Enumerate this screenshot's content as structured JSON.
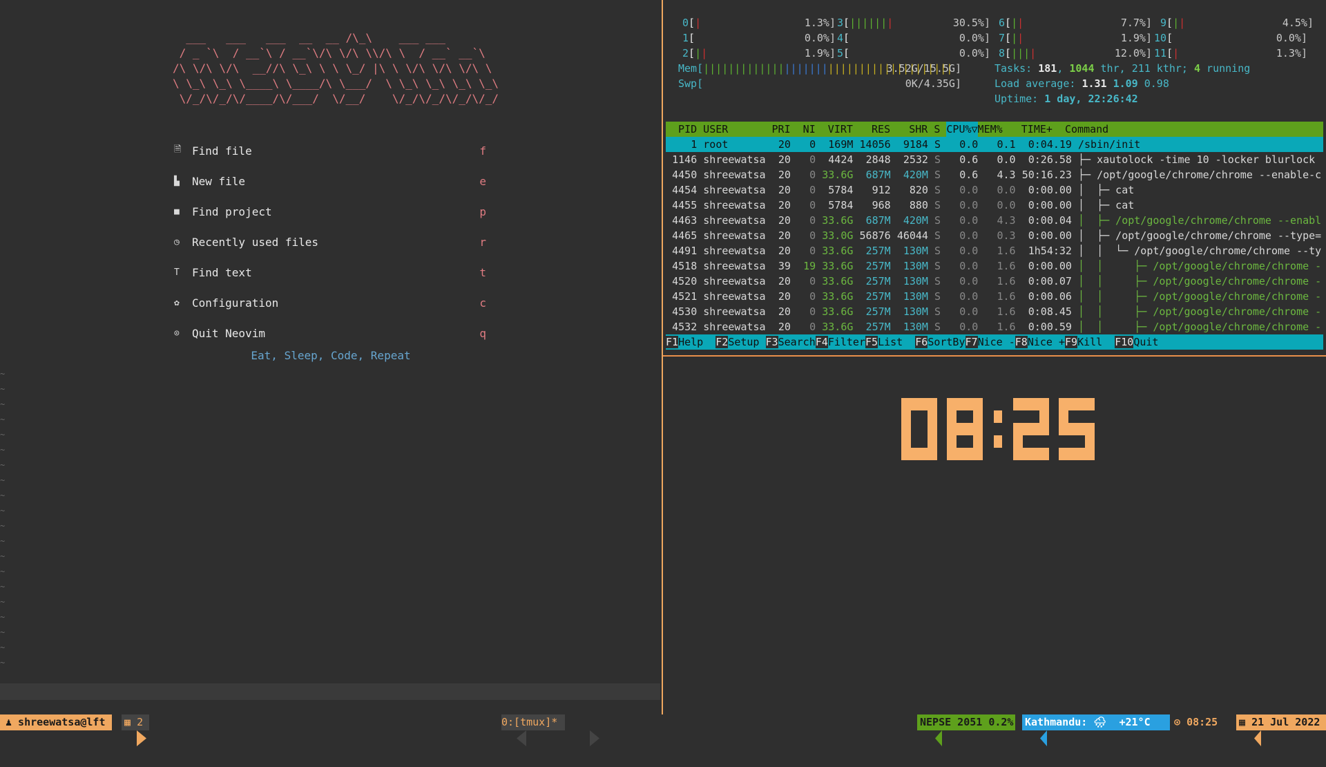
{
  "dashboard": {
    "logo": "  ___   ___   ___  __  __ /\\_\\    ___ ___\n / _ `\\  / __`\\ / __`\\/\\ \\/\\ \\\\/\\ \\  / __` __`\\\n/\\ \\/\\ \\/\\  __//\\ \\_\\ \\ \\ \\_/ |\\ \\ \\/\\ \\/\\ \\/\\ \\\n\\ \\_\\ \\_\\ \\____\\ \\____/\\ \\___/  \\ \\_\\ \\_\\ \\_\\ \\_\\\n \\/_/\\/_/\\/____/\\/___/  \\/__/    \\/_/\\/_/\\/_/\\/_/",
    "items": [
      {
        "icon": "find-file-icon",
        "glyph": "🗎",
        "label": "Find file",
        "key": "f"
      },
      {
        "icon": "new-file-icon",
        "glyph": "▙",
        "label": "New file",
        "key": "e"
      },
      {
        "icon": "folder-icon",
        "glyph": "■",
        "label": "Find project",
        "key": "p"
      },
      {
        "icon": "clock-icon",
        "glyph": "◷",
        "label": "Recently used files",
        "key": "r"
      },
      {
        "icon": "text-icon",
        "glyph": "T",
        "label": "Find text",
        "key": "t"
      },
      {
        "icon": "gear-icon",
        "glyph": "✿",
        "label": "Configuration",
        "key": "c"
      },
      {
        "icon": "power-icon",
        "glyph": "⊙",
        "label": "Quit Neovim",
        "key": "q"
      }
    ],
    "tagline": "Eat, Sleep, Code, Repeat"
  },
  "htop": {
    "cpus": [
      {
        "n": "0",
        "bars": "|",
        "val": "1.3%]"
      },
      {
        "n": "1",
        "bars": "",
        "val": "0.0%]"
      },
      {
        "n": "2",
        "bars": "||",
        "val": "1.9%]"
      },
      {
        "n": "3",
        "bars": "|||||||",
        "val": "30.5%]"
      },
      {
        "n": "4",
        "bars": "",
        "val": "0.0%]"
      },
      {
        "n": "5",
        "bars": "",
        "val": "0.0%]"
      },
      {
        "n": "6",
        "bars": "||",
        "val": "7.7%]"
      },
      {
        "n": "7",
        "bars": "||",
        "val": "1.9%]"
      },
      {
        "n": "8",
        "bars": "||||",
        "val": "12.0%]"
      },
      {
        "n": "9",
        "bars": "||",
        "val": "4.5%]"
      },
      {
        "n": "10",
        "bars": "",
        "val": "0.0%]"
      },
      {
        "n": "11",
        "bars": "|",
        "val": "1.3%]"
      }
    ],
    "mem_label": "Mem[",
    "mem_bars": "||||||||||||||||||||||||||||||||||||||||",
    "mem_val": "3.52G/15.5G]",
    "swp_label": "Swp[",
    "swp_val": "0K/4.35G]",
    "tasks_label": "Tasks: ",
    "tasks": "181",
    "thr": "1044",
    "thr_label": " thr, ",
    "kthr": "211 kthr; ",
    "running": "4",
    "running_label": " running",
    "load_label": "Load average: ",
    "load1": "1.31",
    "load5": "1.09",
    "load15": "0.98",
    "uptime_label": "Uptime: ",
    "uptime": "1 day, 22:26:42",
    "header_left": "  PID USER       PRI  NI  VIRT   RES   SHR S ",
    "header_sort": "CPU%▽",
    "header_right": "MEM%   TIME+  Command",
    "rows": [
      {
        "pid": "1",
        "user": "root",
        "pri": "20",
        "ni": "0",
        "virt": "169M",
        "res": "14056",
        "shr": "9184",
        "s": "S",
        "cpu": "0.0",
        "mem": "0.1",
        "time": "0:04.19",
        "cmd": "/sbin/init"
      },
      {
        "pid": "1146",
        "user": "shreewatsa",
        "pri": "20",
        "ni": "0",
        "virt": "4424",
        "res": "2848",
        "shr": "2532",
        "s": "S",
        "cpu": "0.6",
        "mem": "0.0",
        "time": "0:26.58",
        "cmd": "├─ xautolock -time 10 -locker blurlock"
      },
      {
        "pid": "4450",
        "user": "shreewatsa",
        "pri": "20",
        "ni": "0",
        "virt": "33.6G",
        "res": "687M",
        "shr": "420M",
        "s": "S",
        "cpu": "0.6",
        "mem": "4.3",
        "time": "50:16.23",
        "cmd": "├─ /opt/google/chrome/chrome --enable-c"
      },
      {
        "pid": "4454",
        "user": "shreewatsa",
        "pri": "20",
        "ni": "0",
        "virt": "5784",
        "res": "912",
        "shr": "820",
        "s": "S",
        "cpu": "0.0",
        "mem": "0.0",
        "time": "0:00.00",
        "cmd": "│  ├─ cat"
      },
      {
        "pid": "4455",
        "user": "shreewatsa",
        "pri": "20",
        "ni": "0",
        "virt": "5784",
        "res": "968",
        "shr": "880",
        "s": "S",
        "cpu": "0.0",
        "mem": "0.0",
        "time": "0:00.00",
        "cmd": "│  ├─ cat"
      },
      {
        "pid": "4463",
        "user": "shreewatsa",
        "pri": "20",
        "ni": "0",
        "virt": "33.6G",
        "res": "687M",
        "shr": "420M",
        "s": "S",
        "cpu": "0.0",
        "mem": "4.3",
        "time": "0:00.04",
        "cmd": "│  ├─ /opt/google/chrome/chrome --enabl"
      },
      {
        "pid": "4465",
        "user": "shreewatsa",
        "pri": "20",
        "ni": "0",
        "virt": "33.0G",
        "res": "56876",
        "shr": "46044",
        "s": "S",
        "cpu": "0.0",
        "mem": "0.3",
        "time": "0:00.00",
        "cmd": "│  ├─ /opt/google/chrome/chrome --type="
      },
      {
        "pid": "4491",
        "user": "shreewatsa",
        "pri": "20",
        "ni": "0",
        "virt": "33.6G",
        "res": "257M",
        "shr": "130M",
        "s": "S",
        "cpu": "0.0",
        "mem": "1.6",
        "time": "1h54:32",
        "cmd": "│  │  └─ /opt/google/chrome/chrome --ty"
      },
      {
        "pid": "4518",
        "user": "shreewatsa",
        "pri": "39",
        "ni": "19",
        "virt": "33.6G",
        "res": "257M",
        "shr": "130M",
        "s": "S",
        "cpu": "0.0",
        "mem": "1.6",
        "time": "0:00.00",
        "cmd": "│  │     ├─ /opt/google/chrome/chrome -"
      },
      {
        "pid": "4520",
        "user": "shreewatsa",
        "pri": "20",
        "ni": "0",
        "virt": "33.6G",
        "res": "257M",
        "shr": "130M",
        "s": "S",
        "cpu": "0.0",
        "mem": "1.6",
        "time": "0:00.07",
        "cmd": "│  │     ├─ /opt/google/chrome/chrome -"
      },
      {
        "pid": "4521",
        "user": "shreewatsa",
        "pri": "20",
        "ni": "0",
        "virt": "33.6G",
        "res": "257M",
        "shr": "130M",
        "s": "S",
        "cpu": "0.0",
        "mem": "1.6",
        "time": "0:00.06",
        "cmd": "│  │     ├─ /opt/google/chrome/chrome -"
      },
      {
        "pid": "4530",
        "user": "shreewatsa",
        "pri": "20",
        "ni": "0",
        "virt": "33.6G",
        "res": "257M",
        "shr": "130M",
        "s": "S",
        "cpu": "0.0",
        "mem": "1.6",
        "time": "0:08.45",
        "cmd": "│  │     ├─ /opt/google/chrome/chrome -"
      },
      {
        "pid": "4532",
        "user": "shreewatsa",
        "pri": "20",
        "ni": "0",
        "virt": "33.6G",
        "res": "257M",
        "shr": "130M",
        "s": "S",
        "cpu": "0.0",
        "mem": "1.6",
        "time": "0:00.59",
        "cmd": "│  │     ├─ /opt/google/chrome/chrome -"
      }
    ],
    "fkeys": [
      {
        "k": "F1",
        "l": "Help  "
      },
      {
        "k": "F2",
        "l": "Setup "
      },
      {
        "k": "F3",
        "l": "Search"
      },
      {
        "k": "F4",
        "l": "Filter"
      },
      {
        "k": "F5",
        "l": "List  "
      },
      {
        "k": "F6",
        "l": "SortBy"
      },
      {
        "k": "F7",
        "l": "Nice -"
      },
      {
        "k": "F8",
        "l": "Nice +"
      },
      {
        "k": "F9",
        "l": "Kill  "
      },
      {
        "k": "F10",
        "l": "Quit  "
      }
    ]
  },
  "clock": {
    "time": "08:25",
    "color": "#f7b06a"
  },
  "statusbar": {
    "session": "♟ shreewatsa@lft",
    "windows_icon": "▦",
    "windows": "2",
    "window_name": "0:[tmux]*",
    "nepse": "NEPSE 2051 0.2%",
    "weather": "Kathmandu: 🌧  +21°C",
    "time_icon": "⊙",
    "time": "08:25",
    "date_icon": "▦",
    "date": "21 Jul 2022",
    "colors": {
      "session": "#f0a860",
      "nepse": "#5ea01c",
      "weather": "#2aa0e0",
      "date": "#f0a860"
    }
  }
}
